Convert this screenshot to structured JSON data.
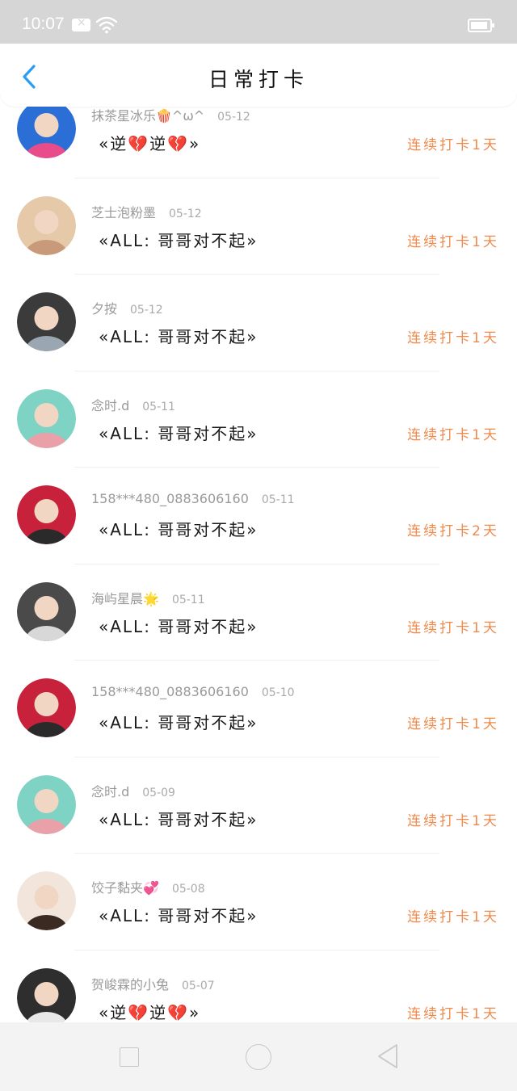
{
  "status_bar": {
    "time": "10:07",
    "icons": [
      "mail-icon",
      "wifi-icon",
      "battery-icon"
    ]
  },
  "header": {
    "back_icon": "back-chevron-icon",
    "title": "日常打卡"
  },
  "colors": {
    "accent": "#2a9df4",
    "streak": "#f08a4b",
    "status_bar_bg": "#d6d6d6"
  },
  "checkins": [
    {
      "name": "抹茶星冰乐🍿^ω^",
      "date": "05-12",
      "text": "«逆💔逆💔»",
      "streak": "连续打卡1天",
      "avatar_colors": [
        "#2b6fd6",
        "#e84c8b"
      ]
    },
    {
      "name": "芝士泡粉墨",
      "date": "05-12",
      "text": "«ALL: 哥哥对不起»",
      "streak": "连续打卡1天",
      "avatar_colors": [
        "#e6c9a8",
        "#c89a7a"
      ]
    },
    {
      "name": "夕按",
      "date": "05-12",
      "text": "«ALL: 哥哥对不起»",
      "streak": "连续打卡1天",
      "avatar_colors": [
        "#3b3b3b",
        "#9aa6b2"
      ]
    },
    {
      "name": "念时.d",
      "date": "05-11",
      "text": "«ALL: 哥哥对不起»",
      "streak": "连续打卡1天",
      "avatar_colors": [
        "#7fd3c4",
        "#e9a0a8"
      ]
    },
    {
      "name": "158***480_0883606160",
      "date": "05-11",
      "text": "«ALL: 哥哥对不起»",
      "streak": "连续打卡2天",
      "avatar_colors": [
        "#c7213b",
        "#2a2a2a"
      ]
    },
    {
      "name": "海屿星晨🌟",
      "date": "05-11",
      "text": "«ALL: 哥哥对不起»",
      "streak": "连续打卡1天",
      "avatar_colors": [
        "#4a4a4a",
        "#d8d8d8"
      ]
    },
    {
      "name": "158***480_0883606160",
      "date": "05-10",
      "text": "«ALL: 哥哥对不起»",
      "streak": "连续打卡1天",
      "avatar_colors": [
        "#c7213b",
        "#2a2a2a"
      ]
    },
    {
      "name": "念时.d",
      "date": "05-09",
      "text": "«ALL: 哥哥对不起»",
      "streak": "连续打卡1天",
      "avatar_colors": [
        "#7fd3c4",
        "#e9a0a8"
      ]
    },
    {
      "name": "饺子黏夹💞",
      "date": "05-08",
      "text": "«ALL: 哥哥对不起»",
      "streak": "连续打卡1天",
      "avatar_colors": [
        "#f2e6dc",
        "#3a2a22"
      ]
    },
    {
      "name": "贺峻霖的小兔",
      "date": "05-07",
      "text": "«逆💔逆💔»",
      "streak": "连续打卡1天",
      "avatar_colors": [
        "#2e2e2e",
        "#e8e8e8"
      ]
    }
  ],
  "bottom_nav": {
    "icons": [
      "recent-apps-icon",
      "home-icon",
      "back-icon"
    ]
  }
}
